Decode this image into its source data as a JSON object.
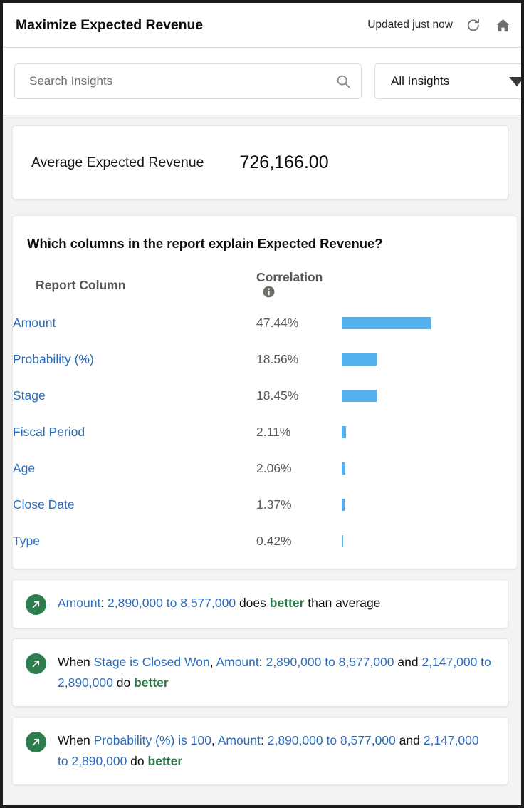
{
  "header": {
    "title": "Maximize Expected Revenue",
    "updated": "Updated just now",
    "refresh_icon": "refresh-icon",
    "home_icon": "home-icon"
  },
  "filters": {
    "search": {
      "placeholder": "Search Insights",
      "value": "",
      "icon": "search-icon"
    },
    "insight_filter": {
      "selected": "All Insights",
      "options": [
        "All Insights"
      ],
      "caret_icon": "chevron-down-icon"
    }
  },
  "metric": {
    "label": "Average Expected Revenue",
    "value": "726,166.00"
  },
  "correlation": {
    "title": "Which columns in the report explain Expected Revenue?",
    "columns": [
      "Report Column",
      "Correlation"
    ],
    "info_icon": "info-icon",
    "rows": [
      {
        "name": "Amount",
        "correlation": "47.44%",
        "value": 47.44
      },
      {
        "name": "Probability (%)",
        "correlation": "18.56%",
        "value": 18.56
      },
      {
        "name": "Stage",
        "correlation": "18.45%",
        "value": 18.45
      },
      {
        "name": "Fiscal Period",
        "correlation": "2.11%",
        "value": 2.11
      },
      {
        "name": "Age",
        "correlation": "2.06%",
        "value": 2.06
      },
      {
        "name": "Close Date",
        "correlation": "1.37%",
        "value": 1.37
      },
      {
        "name": "Type",
        "correlation": "0.42%",
        "value": 0.42
      }
    ]
  },
  "insights": [
    {
      "icon": "arrow-up-right-icon",
      "parts": [
        {
          "text": "Amount",
          "style": "link"
        },
        {
          "text": ": ",
          "style": "plain"
        },
        {
          "text": "2,890,000 to 8,577,000",
          "style": "link"
        },
        {
          "text": " does ",
          "style": "plain"
        },
        {
          "text": "better",
          "style": "positive"
        },
        {
          "text": " than average",
          "style": "plain"
        }
      ]
    },
    {
      "icon": "arrow-up-right-icon",
      "parts": [
        {
          "text": "When ",
          "style": "plain"
        },
        {
          "text": "Stage is Closed Won",
          "style": "link"
        },
        {
          "text": ", ",
          "style": "plain"
        },
        {
          "text": "Amount",
          "style": "link"
        },
        {
          "text": ": ",
          "style": "plain"
        },
        {
          "text": "2,890,000 to 8,577,000",
          "style": "link"
        },
        {
          "text": " and ",
          "style": "plain"
        },
        {
          "text": "2,147,000 to 2,890,000",
          "style": "link"
        },
        {
          "text": " do ",
          "style": "plain"
        },
        {
          "text": "better",
          "style": "positive"
        }
      ]
    },
    {
      "icon": "arrow-up-right-icon",
      "parts": [
        {
          "text": "When ",
          "style": "plain"
        },
        {
          "text": "Probability (%) is 100",
          "style": "link"
        },
        {
          "text": ", ",
          "style": "plain"
        },
        {
          "text": "Amount",
          "style": "link"
        },
        {
          "text": ": ",
          "style": "plain"
        },
        {
          "text": "2,890,000 to 8,577,000",
          "style": "link"
        },
        {
          "text": " and ",
          "style": "plain"
        },
        {
          "text": "2,147,000 to 2,890,000",
          "style": "link"
        },
        {
          "text": " do ",
          "style": "plain"
        },
        {
          "text": "better",
          "style": "positive"
        }
      ]
    }
  ],
  "colors": {
    "link": "#2a6bbd",
    "positive": "#2c7a4b",
    "bar": "#53b1ef",
    "icon_circle": "#2e7d4f",
    "page_bg": "#f3f3f3"
  },
  "chart_data": {
    "type": "bar",
    "title": "Which columns in the report explain Expected Revenue?",
    "categories": [
      "Amount",
      "Probability (%)",
      "Stage",
      "Fiscal Period",
      "Age",
      "Close Date",
      "Type"
    ],
    "values": [
      47.44,
      18.56,
      18.45,
      2.11,
      2.06,
      1.37,
      0.42
    ],
    "xlabel": "Correlation",
    "ylabel": "Report Column",
    "xlim": [
      0,
      47.44
    ],
    "grid": false,
    "legend": null,
    "orientation": "horizontal",
    "unit": "%"
  }
}
